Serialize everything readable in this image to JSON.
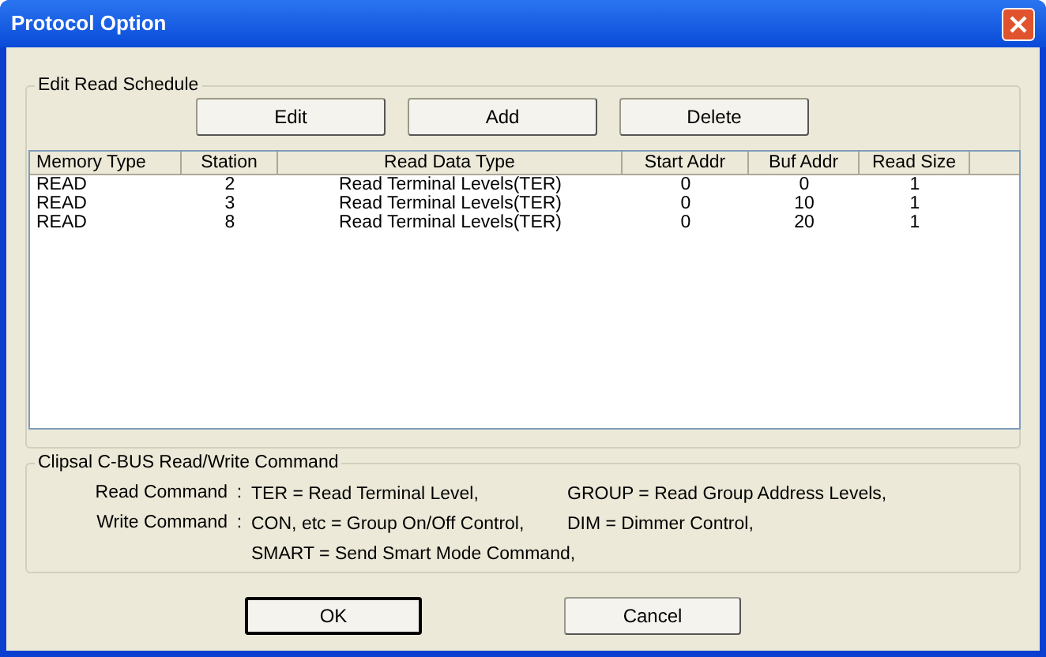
{
  "window": {
    "title": "Protocol Option"
  },
  "schedule": {
    "title": "Edit Read Schedule",
    "buttons": [
      "Edit",
      "Add",
      "Delete"
    ],
    "columns": [
      "Memory Type",
      "Station",
      "Read Data Type",
      "Start Addr",
      "Buf Addr",
      "Read Size"
    ],
    "rows": [
      {
        "cells": [
          "READ",
          "2",
          "Read Terminal Levels(TER)",
          "0",
          "0",
          "1"
        ]
      },
      {
        "cells": [
          "READ",
          "3",
          "Read Terminal Levels(TER)",
          "0",
          "10",
          "1"
        ]
      },
      {
        "cells": [
          "READ",
          "8",
          "Read Terminal Levels(TER)",
          "0",
          "20",
          "1"
        ]
      }
    ]
  },
  "commands": {
    "title": "Clipsal C-BUS Read/Write Command",
    "lines": [
      {
        "label": "Read Command",
        "separator": ":",
        "items": [
          "TER = Read Terminal Level,",
          "GROUP = Read Group Address Levels,"
        ]
      },
      {
        "label": "Write Command",
        "separator": ":",
        "items": [
          "CON, etc = Group On/Off Control,",
          "DIM = Dimmer Control,"
        ]
      },
      {
        "items": [
          "SMART = Send Smart Mode Command,"
        ]
      }
    ]
  },
  "buttons": [
    {
      "label": "OK",
      "default": true
    },
    {
      "label": "Cancel",
      "default": false
    }
  ]
}
